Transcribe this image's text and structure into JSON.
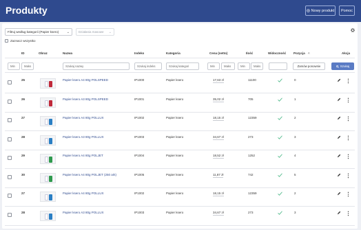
{
  "header": {
    "title": "Produkty",
    "new_product_label": "Nowy produkt",
    "help_label": "Pomoc"
  },
  "toolbar": {
    "category_filter": "Filtruj według kategorii (Papier ksero)",
    "bulk_actions": "Działania masowe",
    "select_all": "Zaznacz wszystko"
  },
  "table": {
    "columns": {
      "id": "ID",
      "image": "Obraz",
      "name": "Nazwa",
      "index": "Indeks",
      "category": "Kategoria",
      "price": "Cena (netto)",
      "qty": "Ilość",
      "visible": "Widoczność",
      "position": "Pozycja",
      "actions": "Akcja"
    },
    "filters": {
      "id_min": "Min",
      "id_max": "Maks",
      "name": "Szukaj nazwy",
      "index": "Szukaj indeks",
      "category": "Szukaj kategori",
      "price_min": "Min",
      "price_max": "Maks",
      "qty_min": "Min",
      "qty_max": "Maks",
      "position_button": "Zamów ponownie",
      "search_button": "Szukaj"
    },
    "rows": [
      {
        "id": "25",
        "name": "Papier ksero A4 80g POLSPEED",
        "index": "IP1000",
        "category": "Papier ksero",
        "price": "17,63 zł",
        "qty": "11100",
        "position": "0",
        "color": "#c0293a"
      },
      {
        "id": "26",
        "name": "Papier ksero A3 80g POLSPEED",
        "index": "IP1001",
        "category": "Papier ksero",
        "price": "35,02 zł",
        "qty": "705",
        "position": "1",
        "color": "#c0293a"
      },
      {
        "id": "27",
        "name": "Papier ksero A4 80g POLLUX",
        "index": "IP1002",
        "category": "Papier ksero",
        "price": "18,15 zł",
        "qty": "12359",
        "position": "2",
        "color": "#2a7fc4"
      },
      {
        "id": "28",
        "name": "Papier ksero A3 80g POLLUX",
        "index": "IP1003",
        "category": "Papier ksero",
        "price": "34,67 zł",
        "qty": "273",
        "position": "3",
        "color": "#2a7fc4"
      },
      {
        "id": "29",
        "name": "Papier ksero A4 80g POLJET",
        "index": "IP1004",
        "category": "Papier ksero",
        "price": "18,52 zł",
        "qty": "1252",
        "position": "4",
        "color": "#2f9a4e"
      },
      {
        "id": "30",
        "name": "Papier ksero A4 80g POLJET (250 ark)",
        "index": "IP1005",
        "category": "Papier ksero",
        "price": "11,87 zł",
        "qty": "742",
        "position": "5",
        "color": "#2f9a4e"
      },
      {
        "id": "27",
        "name": "Papier ksero A4 80g POLLUX",
        "index": "IP1002",
        "category": "Papier ksero",
        "price": "18,15 zł",
        "qty": "12359",
        "position": "2",
        "color": "#2a7fc4"
      },
      {
        "id": "28",
        "name": "Papier ksero A3 80g POLLUX",
        "index": "IP1003",
        "category": "Papier ksero",
        "price": "34,67 zł",
        "qty": "273",
        "position": "3",
        "color": "#2a7fc4"
      }
    ]
  },
  "colors": {
    "header": "#2f4a8e",
    "link": "#2f4a8e",
    "check": "#3fb37f",
    "search_button": "#5a7bc4"
  }
}
